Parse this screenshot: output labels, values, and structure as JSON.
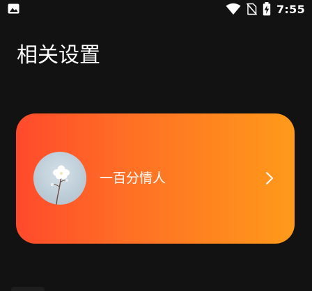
{
  "status_bar": {
    "time": "7:55",
    "icons": [
      "image-notification-icon",
      "wifi-icon",
      "no-sim-icon",
      "battery-charging-icon"
    ]
  },
  "header": {
    "title": "相关设置"
  },
  "card": {
    "label": "一百分情人",
    "avatar_icon": "flower-avatar",
    "chevron_icon": "chevron-right-icon",
    "gradient_start": "#ff4a2c",
    "gradient_end": "#ff9a1a"
  },
  "colors": {
    "background": "#121212",
    "text": "#ffffff"
  }
}
